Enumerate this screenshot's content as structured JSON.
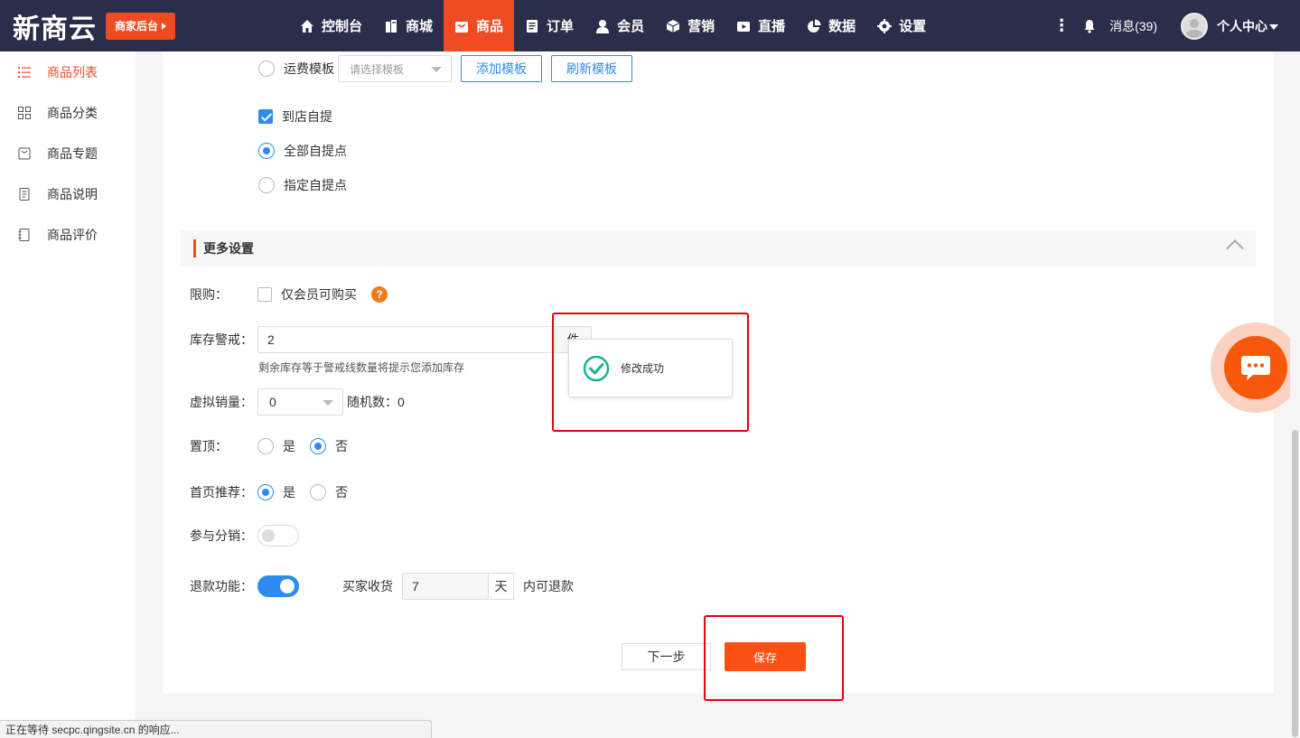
{
  "header": {
    "logo": "新商云",
    "admin_badge": "商家后台",
    "nav": [
      {
        "label": "控制台",
        "icon": "home-icon"
      },
      {
        "label": "商城",
        "icon": "building-icon"
      },
      {
        "label": "商品",
        "icon": "bag-icon",
        "active": true
      },
      {
        "label": "订单",
        "icon": "clipboard-icon"
      },
      {
        "label": "会员",
        "icon": "user-icon"
      },
      {
        "label": "营销",
        "icon": "cube-icon"
      },
      {
        "label": "直播",
        "icon": "play-icon"
      },
      {
        "label": "数据",
        "icon": "pie-chart-icon"
      },
      {
        "label": "设置",
        "icon": "gear-icon"
      }
    ],
    "messages": "消息(39)",
    "user_center": "个人中心"
  },
  "sidebar": {
    "items": [
      {
        "label": "商品列表",
        "icon": "list-icon",
        "active": true
      },
      {
        "label": "商品分类",
        "icon": "grid-icon"
      },
      {
        "label": "商品专题",
        "icon": "tag-icon"
      },
      {
        "label": "商品说明",
        "icon": "document-icon"
      },
      {
        "label": "商品评价",
        "icon": "review-icon"
      }
    ]
  },
  "shipping": {
    "freight_label": "运费模板",
    "freight_placeholder": "请选择模板",
    "add_template": "添加模板",
    "refresh_template": "刷新模板",
    "pickup_label": "到店自提",
    "all_pickup": "全部自提点",
    "specific_pickup": "指定自提点"
  },
  "more": {
    "section_title": "更多设置",
    "limit_label": "限购：",
    "member_only": "仅会员可购买",
    "help": "?",
    "stock_label": "库存警戒：",
    "stock_value": "2",
    "stock_unit": "件",
    "stock_hint": "剩余库存等于警戒线数量将提示您添加库存",
    "virtual_label": "虚拟销量：",
    "virtual_value": "0",
    "random_label": "随机数：0",
    "top_label": "置顶：",
    "yes": "是",
    "no": "否",
    "home_label": "首页推荐：",
    "distribution_label": "参与分销：",
    "refund_label": "退款功能：",
    "buyer_receive": "买家收货",
    "refund_days": "7",
    "day_unit": "天",
    "refund_suffix": "内可退款"
  },
  "buttons": {
    "next": "下一步",
    "save": "保存"
  },
  "toast": {
    "message": "修改成功"
  },
  "status_bar": "正在等待 secpc.qingsite.cn 的响应...",
  "state": {
    "pickup_checked": true,
    "all_pickup_selected": true,
    "member_only_checked": false,
    "top": "否",
    "home_recommend": "是",
    "distribution_on": false,
    "refund_on": true
  },
  "colors": {
    "brand": "#f04b23",
    "nav_bg": "#2b2e4a",
    "primary": "#2d8cf0",
    "annotation": "#e60012"
  }
}
